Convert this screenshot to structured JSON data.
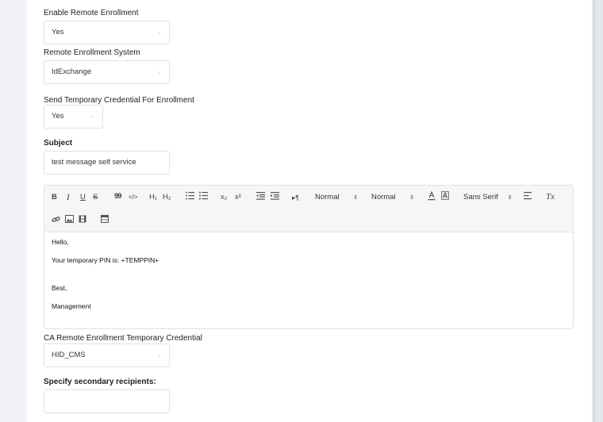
{
  "fields": {
    "enable_remote_enrollment": {
      "label": "Enable Remote Enrollment",
      "value": "Yes"
    },
    "remote_enrollment_system": {
      "label": "Remote Enrollment System",
      "value": "IdExchange"
    },
    "send_temp_credential": {
      "label": "Send Temporary Credential For Enrollment",
      "value": "Yes"
    },
    "subject": {
      "label": "Subject",
      "value": "test message self service"
    },
    "ca_remote_enrollment": {
      "label": "CA Remote Enrollment Temporary Credential",
      "value": "HID_CMS"
    },
    "secondary_recipients": {
      "label": "Specify secondary recipients:",
      "value": ""
    }
  },
  "toolbar": {
    "bold": "B",
    "italic": "I",
    "underline": "U",
    "strike": "S",
    "blockquote": "99",
    "code": "</>",
    "h1": "H₁",
    "h2": "H₂",
    "superscript_x": "x²",
    "subscript_x": "x₂",
    "rtl": "▸¶",
    "size_select": "Normal",
    "header_select": "Normal",
    "font_select": "Sans Serif",
    "clean": "Tx"
  },
  "editor": {
    "lines": [
      "Hello,",
      "Your temporary PIN is: +TEMPPIN+",
      "Best,",
      "Management"
    ]
  },
  "colors": {
    "panel": "#ffffff",
    "background": "#f0f2f5",
    "border": "#dde1e6"
  }
}
